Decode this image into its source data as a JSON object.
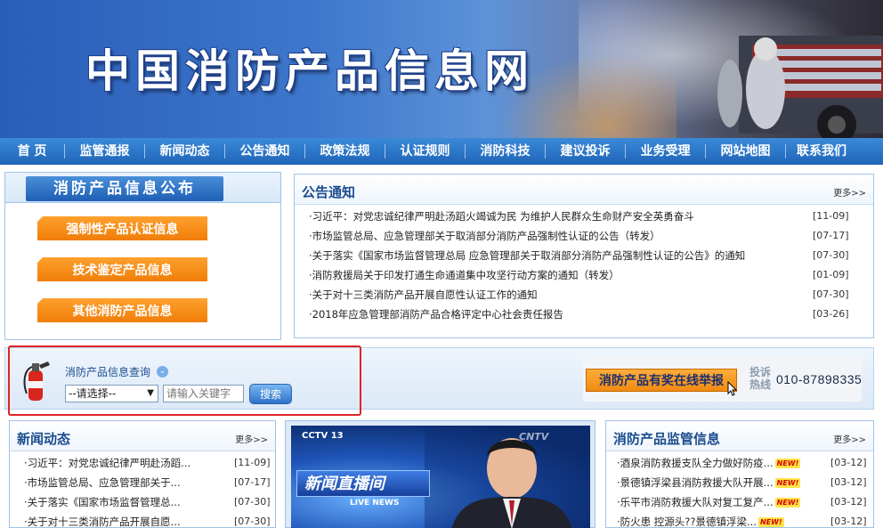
{
  "site": {
    "title": "中国消防产品信息网"
  },
  "nav": [
    "首 页",
    "监管通报",
    "新闻动态",
    "公告通知",
    "政策法规",
    "认证规则",
    "消防科技",
    "建议投诉",
    "业务受理",
    "网站地图",
    "联系我们"
  ],
  "info_panel": {
    "title": "消防产品信息公布",
    "buttons": [
      "强制性产品认证信息",
      "技术鉴定产品信息",
      "其他消防产品信息"
    ]
  },
  "notices": {
    "title": "公告通知",
    "more": "更多>>",
    "items": [
      {
        "text": "·习近平：对党忠诚纪律严明赴汤蹈火竭诚为民 为维护人民群众生命财产安全英勇奋斗",
        "date": "[11-09]"
      },
      {
        "text": "·市场监管总局、应急管理部关于取消部分消防产品强制性认证的公告（转发）",
        "date": "[07-17]"
      },
      {
        "text": "·关于落实《国家市场监督管理总局 应急管理部关于取消部分消防产品强制性认证的公告》的通知",
        "date": "[07-30]"
      },
      {
        "text": "·消防救援局关于印发打通生命通道集中攻坚行动方案的通知（转发）",
        "date": "[01-09]"
      },
      {
        "text": "·关于对十三类消防产品开展自愿性认证工作的通知",
        "date": "[07-30]"
      },
      {
        "text": "·2018年应急管理部消防产品合格评定中心社会责任报告",
        "date": "[03-26]"
      }
    ]
  },
  "search": {
    "label": "消防产品信息查询",
    "select_value": "--请选择--",
    "placeholder": "请输入关键字",
    "button": "搜索"
  },
  "report": {
    "button": "消防产品有奖在线举报",
    "hotline_label": "投诉热线",
    "hotline_number": "010-87898335"
  },
  "news": {
    "title": "新闻动态",
    "more": "更多>>",
    "items": [
      {
        "text": "·习近平：对党忠诚纪律严明赴汤蹈...",
        "date": "[11-09]"
      },
      {
        "text": "·市场监管总局、应急管理部关于...",
        "date": "[07-17]"
      },
      {
        "text": "·关于落实《国家市场监督管理总...",
        "date": "[07-30]"
      },
      {
        "text": "·关于对十三类消防产品开展自愿...",
        "date": "[07-30]"
      }
    ]
  },
  "video": {
    "logo": "CCTV 13",
    "cntv": "CNTV",
    "caption": "新闻直播间",
    "caption_en": "LIVE NEWS"
  },
  "supervision": {
    "title": "消防产品监管信息",
    "more": "更多>>",
    "new_badge": "NEW!",
    "items": [
      {
        "text": "·酒泉消防救援支队全力做好防疫...",
        "date": "[03-12]"
      },
      {
        "text": "·景德镇浮梁县消防救援大队开展...",
        "date": "[03-12]"
      },
      {
        "text": "·乐平市消防救援大队对复工复产...",
        "date": "[03-12]"
      },
      {
        "text": "·防火患 控源头??景德镇浮梁...",
        "date": "[03-12]"
      }
    ]
  },
  "colors": {
    "nav": "#1f64b8",
    "accent_orange": "#f07d08",
    "highlight_red": "#e02424"
  }
}
